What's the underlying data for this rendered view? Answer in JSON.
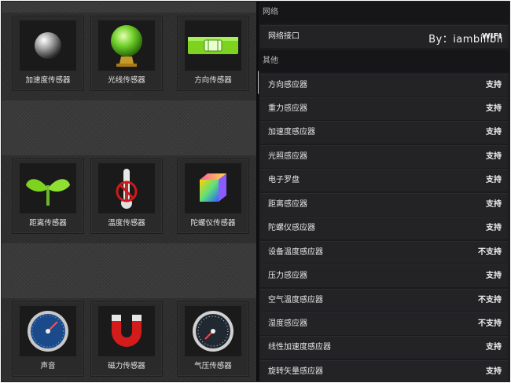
{
  "left": {
    "tiles": [
      {
        "label": "加速度传感器",
        "icon": "metal-ball-icon"
      },
      {
        "label": "光线传感器",
        "icon": "crystal-ball-icon"
      },
      {
        "label": "方向传感器",
        "icon": "spirit-level-icon"
      },
      {
        "label": "距离传感器",
        "icon": "sprout-icon"
      },
      {
        "label": "温度传感器",
        "icon": "thermometer-disabled-icon"
      },
      {
        "label": "陀螺仪传感器",
        "icon": "color-cube-icon"
      },
      {
        "label": "声音",
        "icon": "sound-gauge-icon"
      },
      {
        "label": "磁力传感器",
        "icon": "magnet-icon"
      },
      {
        "label": "气压传感器",
        "icon": "barometer-icon"
      }
    ]
  },
  "right": {
    "network_header": "网络",
    "network_row": {
      "name": "网络接口",
      "value": "WIFI"
    },
    "watermark": "By：iambillbli",
    "other_header": "其他",
    "rows": [
      {
        "name": "方向感应器",
        "value": "支持"
      },
      {
        "name": "重力感应器",
        "value": "支持"
      },
      {
        "name": "加速度感应器",
        "value": "支持"
      },
      {
        "name": "光照感应器",
        "value": "支持"
      },
      {
        "name": "电子罗盘",
        "value": "支持"
      },
      {
        "name": "距离感应器",
        "value": "支持"
      },
      {
        "name": "陀螺仪感应器",
        "value": "支持"
      },
      {
        "name": "设备温度感应器",
        "value": "不支持"
      },
      {
        "name": "压力感应器",
        "value": "支持"
      },
      {
        "name": "空气温度感应器",
        "value": "不支持"
      },
      {
        "name": "湿度感应器",
        "value": "不支持"
      },
      {
        "name": "线性加速度感应器",
        "value": "支持"
      },
      {
        "name": "旋转矢量感应器",
        "value": "支持"
      }
    ]
  }
}
